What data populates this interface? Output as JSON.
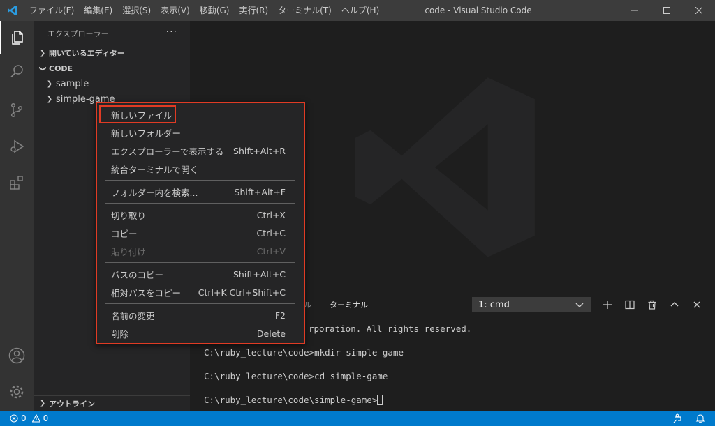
{
  "titlebar": {
    "menu": [
      "ファイル(F)",
      "編集(E)",
      "選択(S)",
      "表示(V)",
      "移動(G)",
      "実行(R)",
      "ターミナル(T)",
      "ヘルプ(H)"
    ],
    "window_title": "code - Visual Studio Code"
  },
  "sidebar": {
    "title": "エクスプローラー",
    "open_editors": "開いているエディター",
    "folder": "CODE",
    "items": [
      "sample",
      "simple-game"
    ],
    "outline": "アウトライン"
  },
  "panel": {
    "tabs": [
      "ール",
      "ターミナル"
    ],
    "terminal_select": "1: cmd",
    "terminal_lines": [
      "rporation. All rights reserved.",
      "C:\\ruby_lecture\\code>mkdir simple-game",
      "C:\\ruby_lecture\\code>cd simple-game",
      "C:\\ruby_lecture\\code\\simple-game>"
    ]
  },
  "context_menu": {
    "groups": [
      [
        {
          "label": "新しいファイル",
          "shortcut": ""
        },
        {
          "label": "新しいフォルダー",
          "shortcut": ""
        },
        {
          "label": "エクスプローラーで表示する",
          "shortcut": "Shift+Alt+R"
        },
        {
          "label": "統合ターミナルで開く",
          "shortcut": ""
        }
      ],
      [
        {
          "label": "フォルダー内を検索...",
          "shortcut": "Shift+Alt+F"
        }
      ],
      [
        {
          "label": "切り取り",
          "shortcut": "Ctrl+X"
        },
        {
          "label": "コピー",
          "shortcut": "Ctrl+C"
        },
        {
          "label": "貼り付け",
          "shortcut": "Ctrl+V",
          "disabled": true
        }
      ],
      [
        {
          "label": "パスのコピー",
          "shortcut": "Shift+Alt+C"
        },
        {
          "label": "相対パスをコピー",
          "shortcut": "Ctrl+K Ctrl+Shift+C"
        }
      ],
      [
        {
          "label": "名前の変更",
          "shortcut": "F2"
        },
        {
          "label": "削除",
          "shortcut": "Delete"
        }
      ]
    ]
  },
  "statusbar": {
    "errors": "0",
    "warnings": "0"
  },
  "colors": {
    "accent": "#007acc",
    "highlight": "#e03b24"
  }
}
